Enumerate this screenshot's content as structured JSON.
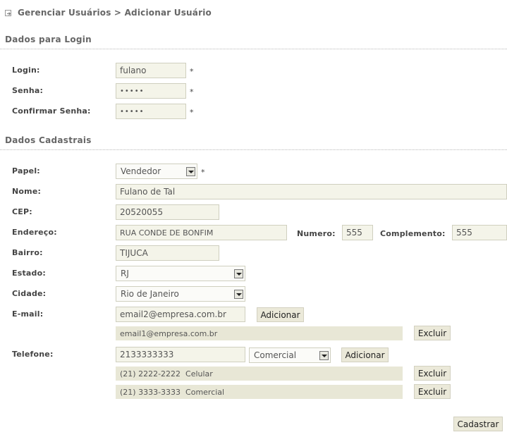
{
  "breadcrumb": {
    "text": "Gerenciar Usuários > Adicionar Usuário"
  },
  "login_section": {
    "title": "Dados para Login",
    "login_label": "Login:",
    "login_value": "fulano",
    "senha_label": "Senha:",
    "senha_value": "•••••",
    "confirmar_label": "Confirmar Senha:",
    "confirmar_value": "•••••",
    "required_mark": "*"
  },
  "cadastro_section": {
    "title": "Dados Cadastrais",
    "papel_label": "Papel:",
    "papel_value": "Vendedor",
    "nome_label": "Nome:",
    "nome_value": "Fulano de Tal",
    "cep_label": "CEP:",
    "cep_value": "20520055",
    "endereco_label": "Endereço:",
    "endereco_value": "RUA CONDE DE BONFIM",
    "numero_label": "Numero:",
    "numero_value": "555",
    "complemento_label": "Complemento:",
    "complemento_value": "555",
    "bairro_label": "Bairro:",
    "bairro_value": "TIJUCA",
    "estado_label": "Estado:",
    "estado_value": "RJ",
    "cidade_label": "Cidade:",
    "cidade_value": "Rio de Janeiro",
    "email_label": "E-mail:",
    "email_value": "email2@empresa.com.br",
    "email_add_label": "Adicionar",
    "emails": [
      {
        "text": "email1@empresa.com.br",
        "remove_label": "Excluir"
      }
    ],
    "telefone_label": "Telefone:",
    "telefone_value": "2133333333",
    "telefone_tipo": "Comercial",
    "telefone_add_label": "Adicionar",
    "telefones": [
      {
        "text": "(21) 2222-2222  Celular",
        "remove_label": "Excluir"
      },
      {
        "text": "(21) 3333-3333  Comercial",
        "remove_label": "Excluir"
      }
    ]
  },
  "submit_label": "Cadastrar"
}
